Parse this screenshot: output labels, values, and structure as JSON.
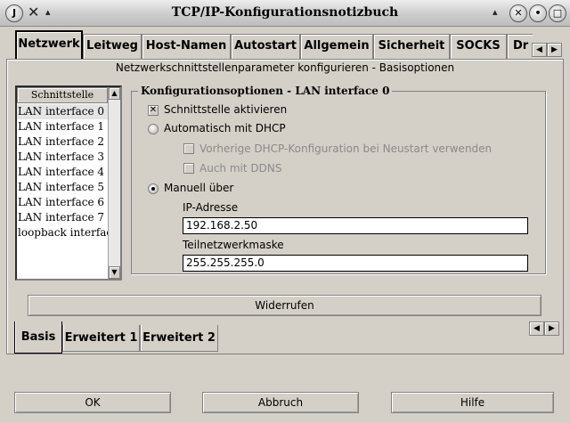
{
  "window": {
    "title": "TCP/IP-Konfigurationsnotizbuch"
  },
  "tabs_top": [
    {
      "label": "Netzwerk",
      "active": true
    },
    {
      "label": "Leitweg"
    },
    {
      "label": "Host-Namen"
    },
    {
      "label": "Autostart"
    },
    {
      "label": "Allgemein"
    },
    {
      "label": "Sicherheit"
    },
    {
      "label": "SOCKS"
    },
    {
      "label": "Dr"
    }
  ],
  "subtitle": "Netzwerkschnittstellenparameter konfigurieren - Basisoptionen",
  "interface_list": {
    "header": "Schnittstelle",
    "items": [
      "LAN interface 0",
      "LAN interface 1",
      "LAN interface 2",
      "LAN interface 3",
      "LAN interface 4",
      "LAN interface 5",
      "LAN interface 6",
      "LAN interface 7",
      "loopback interfac"
    ],
    "selected": "LAN interface 0"
  },
  "config": {
    "title": "Konfigurationsoptionen - LAN interface 0",
    "enable_label": "Schnittstelle aktivieren",
    "enable_checked": true,
    "dhcp_label": "Automatisch mit DHCP",
    "dhcp_prev_label": "Vorherige DHCP-Konfiguration bei Neustart verwenden",
    "ddns_label": "Auch mit DDNS",
    "manual_label": "Manuell über",
    "manual_selected": true,
    "ip_label": "IP-Adresse",
    "ip_value": "192.168.2.50",
    "mask_label": "Teilnetzwerkmaske",
    "mask_value": "255.255.255.0"
  },
  "undo_label": "Widerrufen",
  "subtabs": [
    {
      "label": "Basis",
      "active": true
    },
    {
      "label": "Erweitert 1"
    },
    {
      "label": "Erweitert 2"
    }
  ],
  "buttons": {
    "ok": "OK",
    "cancel": "Abbruch",
    "help": "Hilfe"
  }
}
